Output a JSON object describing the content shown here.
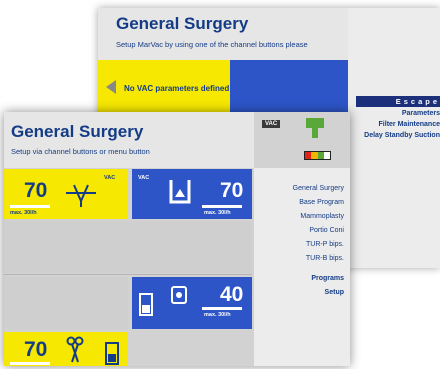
{
  "back_screen": {
    "title": "General Surgery",
    "subtitle": "Setup MarVac by using one of the channel buttons please",
    "notice": "No VAC parameters defined",
    "escape_label": "Escape",
    "menu": [
      "Parameters",
      "Filter Maintenance",
      "Delay Standby Suction"
    ]
  },
  "front_screen": {
    "title": "General Surgery",
    "subtitle": "Setup via channel buttons or menu button",
    "vac_badge": "VAC",
    "channels": {
      "ch1": {
        "value": "70",
        "tag": "VAC",
        "unit": "max. 30l/h"
      },
      "ch2": {
        "value": "70",
        "tag": "VAC",
        "unit": "max. 30l/h"
      },
      "ch3": {
        "value": "40",
        "unit": "max. 30l/h"
      },
      "ch4": {
        "value": "70"
      }
    },
    "menu_items": [
      "General Surgery",
      "Base Program",
      "Mammoplasty",
      "Portio Coni",
      "TUR-P bips.",
      "TUR-B bips."
    ],
    "menu_actions": [
      "Programs",
      "Setup"
    ]
  },
  "colors": {
    "brand_blue": "#143c86",
    "panel_yellow": "#f6e800",
    "panel_blue": "#2d55c7",
    "status_green": "#5aa83a"
  }
}
